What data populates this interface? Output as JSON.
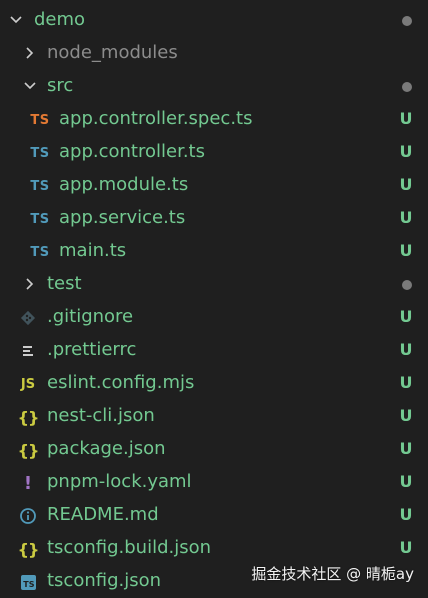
{
  "explorer": {
    "root": {
      "label": "demo",
      "expanded": true,
      "has_changes": true
    },
    "items": [
      {
        "label": "node_modules",
        "type": "folder",
        "expanded": false,
        "color": "#8c8c8c",
        "status": ""
      },
      {
        "label": "src",
        "type": "folder",
        "expanded": true,
        "color": "#73c991",
        "status": "dot"
      },
      {
        "label": "app.controller.spec.ts",
        "type": "file",
        "icon": "typescript-test-icon",
        "icon_text": "TS",
        "icon_color": "#e37933",
        "color": "#73c991",
        "status": "U"
      },
      {
        "label": "app.controller.ts",
        "type": "file",
        "icon": "typescript-icon",
        "icon_text": "TS",
        "icon_color": "#519aba",
        "color": "#73c991",
        "status": "U"
      },
      {
        "label": "app.module.ts",
        "type": "file",
        "icon": "typescript-icon",
        "icon_text": "TS",
        "icon_color": "#519aba",
        "color": "#73c991",
        "status": "U"
      },
      {
        "label": "app.service.ts",
        "type": "file",
        "icon": "typescript-icon",
        "icon_text": "TS",
        "icon_color": "#519aba",
        "color": "#73c991",
        "status": "U"
      },
      {
        "label": "main.ts",
        "type": "file",
        "icon": "typescript-icon",
        "icon_text": "TS",
        "icon_color": "#519aba",
        "color": "#73c991",
        "status": "U"
      },
      {
        "label": "test",
        "type": "folder",
        "expanded": false,
        "color": "#73c991",
        "status": "dot"
      },
      {
        "label": ".gitignore",
        "type": "file",
        "icon": "git-icon",
        "icon_color": "#41535b",
        "color": "#73c991",
        "status": "U"
      },
      {
        "label": ".prettierrc",
        "type": "file",
        "icon": "config-lines-icon",
        "icon_color": "#cccccc",
        "color": "#73c991",
        "status": "U"
      },
      {
        "label": "eslint.config.mjs",
        "type": "file",
        "icon": "javascript-icon",
        "icon_text": "JS",
        "icon_color": "#cbcb41",
        "color": "#73c991",
        "status": "U"
      },
      {
        "label": "nest-cli.json",
        "type": "file",
        "icon": "json-icon",
        "icon_text": "{}",
        "icon_color": "#cbcb41",
        "color": "#73c991",
        "status": "U"
      },
      {
        "label": "package.json",
        "type": "file",
        "icon": "json-icon",
        "icon_text": "{}",
        "icon_color": "#cbcb41",
        "color": "#73c991",
        "status": "U"
      },
      {
        "label": "pnpm-lock.yaml",
        "type": "file",
        "icon": "yaml-icon",
        "icon_text": "!",
        "icon_color": "#a074c4",
        "color": "#73c991",
        "status": "U"
      },
      {
        "label": "README.md",
        "type": "file",
        "icon": "info-icon",
        "icon_color": "#519aba",
        "color": "#73c991",
        "status": "U"
      },
      {
        "label": "tsconfig.build.json",
        "type": "file",
        "icon": "json-icon",
        "icon_text": "{}",
        "icon_color": "#cbcb41",
        "color": "#73c991",
        "status": "U"
      },
      {
        "label": "tsconfig.json",
        "type": "file",
        "icon": "tsconfig-icon",
        "icon_text": "TS",
        "icon_color": "#519aba",
        "color": "#73c991",
        "status": "U"
      }
    ]
  },
  "watermark": {
    "text": "掘金技术社区 @ 晴栀ay"
  }
}
